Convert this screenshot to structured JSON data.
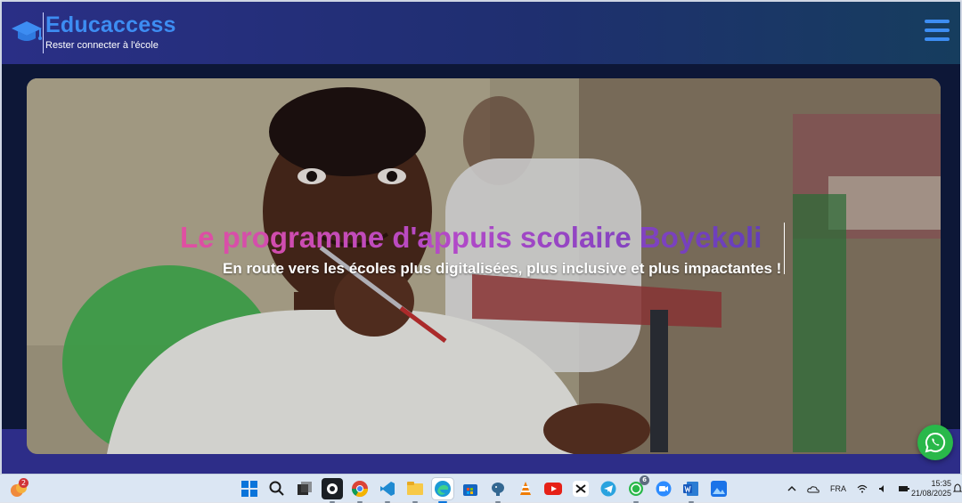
{
  "header": {
    "brand": "Educaccess",
    "tagline": "Rester connecter à l'école"
  },
  "hero": {
    "title": "Le programme d'appuis scolaire Boyekoli",
    "subtitle": "En route vers les écoles plus digitalisées, plus inclusive et plus impactantes !"
  },
  "colors": {
    "header_start": "#2a2f86",
    "brand": "#3d8df2",
    "title_gradient_start": "#e14fa1",
    "title_gradient_end": "#5b3db9",
    "whatsapp": "#29b84a"
  },
  "taskbar": {
    "notification_badge": "2",
    "icons": [
      {
        "name": "windows-start-icon",
        "count": ""
      },
      {
        "name": "search-icon",
        "count": ""
      },
      {
        "name": "task-view-icon",
        "count": ""
      },
      {
        "name": "github-icon",
        "count": ""
      },
      {
        "name": "chrome-icon",
        "count": ""
      },
      {
        "name": "vscode-icon",
        "count": ""
      },
      {
        "name": "file-explorer-icon",
        "count": ""
      },
      {
        "name": "edge-icon",
        "count": ""
      },
      {
        "name": "store-icon",
        "count": ""
      },
      {
        "name": "postgres-icon",
        "count": ""
      },
      {
        "name": "vlc-icon",
        "count": ""
      },
      {
        "name": "youtube-icon",
        "count": ""
      },
      {
        "name": "capcut-icon",
        "count": ""
      },
      {
        "name": "telegram-icon",
        "count": ""
      },
      {
        "name": "whatsapp-app-icon",
        "count": "6"
      },
      {
        "name": "zoom-icon",
        "count": ""
      },
      {
        "name": "word-icon",
        "count": ""
      },
      {
        "name": "photos-icon",
        "count": ""
      }
    ],
    "tray": {
      "language": "FRA"
    },
    "clock": {
      "time": "15:35",
      "date": "21/08/2025"
    }
  }
}
